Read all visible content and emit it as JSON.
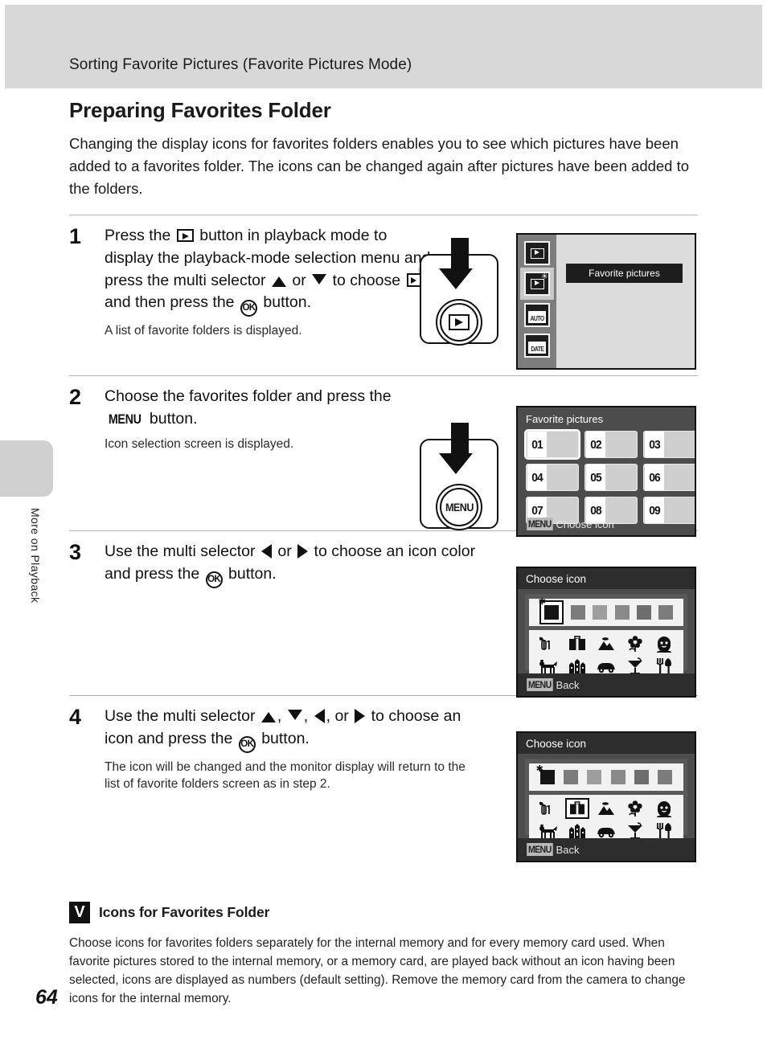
{
  "header": {
    "title": "Sorting Favorite Pictures (Favorite Pictures Mode)"
  },
  "sidebar": {
    "chapter_label": "More on Playback",
    "page_number": "64"
  },
  "section": {
    "title": "Preparing Favorites Folder",
    "intro": "Changing the display icons for favorites folders enables you to see which pictures have been added to a favorites folder. The icons can be changed again after pictures have been added to the folders."
  },
  "steps": [
    {
      "number": "1",
      "text_parts": {
        "a": "Press the",
        "b": "button in playback mode to display the playback-mode selection menu and press the multi selector",
        "c": "or",
        "d": "to choose",
        "e": ", and then press the",
        "f": "button."
      },
      "sub": "A list of favorite folders is displayed."
    },
    {
      "number": "2",
      "text_parts": {
        "a": "Choose the favorites folder and press the",
        "menu": "MENU",
        "b": "button."
      },
      "sub": "Icon selection screen is displayed."
    },
    {
      "number": "3",
      "text_parts": {
        "a": "Use the multi selector",
        "b": "or",
        "c": "to choose an icon color and press the",
        "d": "button."
      },
      "sub": ""
    },
    {
      "number": "4",
      "text_parts": {
        "a": "Use the multi selector",
        "b": ",",
        "c": ",",
        "d": ", or",
        "e": "to choose an icon and press the",
        "f": "button."
      },
      "sub": "The icon will be changed and the monitor display will return to the list of favorite folders screen as in step 2."
    }
  ],
  "button_diagrams": [
    {
      "name": "playback-button",
      "label": ""
    },
    {
      "name": "menu-button",
      "label": "MENU"
    }
  ],
  "screens": {
    "playback_mode_select": {
      "menu_item": "Favorite pictures",
      "mode_icons": [
        "playback-icon",
        "favorite-pictures-icon",
        "auto-sort-icon",
        "list-by-date-icon"
      ],
      "mode_icon_labels": [
        "",
        "",
        "AUTO",
        "DATE"
      ],
      "selected_index": 1
    },
    "favorite_folder_list": {
      "title": "Favorite pictures",
      "folders": [
        "01",
        "02",
        "03",
        "04",
        "05",
        "06",
        "07",
        "08",
        "09"
      ],
      "selected": "01",
      "footer_badge": "MENU",
      "footer_text": "Choose icon"
    },
    "choose_icon_step3": {
      "title": "Choose icon",
      "colors": [
        "#151515",
        "#7c7c7c",
        "#9e9e9e",
        "#8a8a8a",
        "#6e6e6e",
        "#7c7c7c"
      ],
      "selected_color_index": 0,
      "icons": [
        "sprout-1-icon",
        "briefcase-icon",
        "mountain-icon",
        "flower-icon",
        "face-icon",
        "dog-icon",
        "buildings-icon",
        "car-icon",
        "cocktail-icon",
        "cutlery-icon"
      ],
      "selected_icon_index": -1,
      "footer_badge": "MENU",
      "footer_text": "Back"
    },
    "choose_icon_step4": {
      "title": "Choose icon",
      "colors": [
        "#151515",
        "#7c7c7c",
        "#9e9e9e",
        "#8a8a8a",
        "#6e6e6e",
        "#7c7c7c"
      ],
      "selected_color_index": 0,
      "icons": [
        "sprout-1-icon",
        "briefcase-icon",
        "mountain-icon",
        "flower-icon",
        "face-icon",
        "dog-icon",
        "buildings-icon",
        "car-icon",
        "cocktail-icon",
        "cutlery-icon"
      ],
      "selected_icon_index": 1,
      "footer_badge": "MENU",
      "footer_text": "Back"
    }
  },
  "note": {
    "title": "Icons for Favorites Folder",
    "mark": "V",
    "body": "Choose icons for favorites folders separately for the internal memory and for every memory card used. When favorite pictures stored to the internal memory, or a memory card, are played back without an icon having been selected, icons are displayed as numbers (default setting). Remove the memory card from the camera to change icons for the internal memory."
  },
  "colors": {
    "header_band": "#d8d8d8",
    "screen_bg": "#4c4c4c",
    "screen_panel": "#dcdcdc",
    "screen_dark": "#2d2d2d"
  }
}
